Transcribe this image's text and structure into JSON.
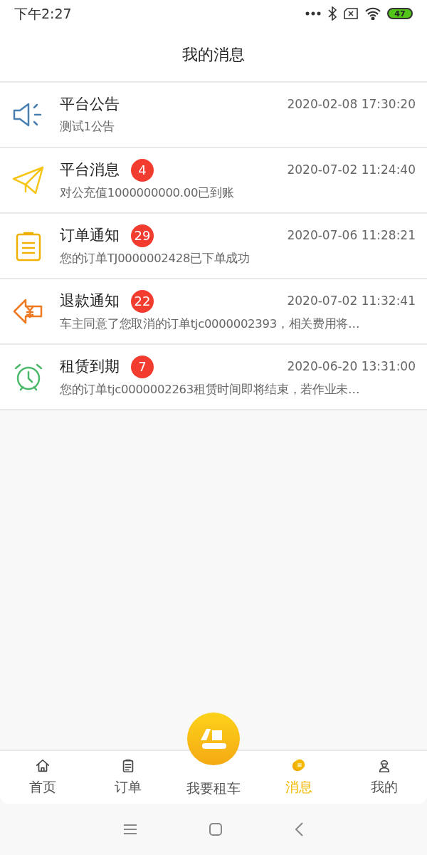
{
  "status_bar": {
    "time": "下午2:27",
    "battery": "47"
  },
  "header": {
    "title": "我的消息"
  },
  "messages": [
    {
      "kind": "announcement",
      "title": "平台公告",
      "time": "2020-02-08 17:30:20",
      "preview": "测试1公告"
    },
    {
      "kind": "platform",
      "title": "平台消息",
      "badge": "4",
      "time": "2020-07-02 11:24:40",
      "preview": "对公充值1000000000.00已到账"
    },
    {
      "kind": "order",
      "title": "订单通知",
      "badge": "29",
      "time": "2020-07-06 11:28:21",
      "preview": "您的订单TJ0000002428已下单成功"
    },
    {
      "kind": "refund",
      "title": "退款通知",
      "badge": "22",
      "time": "2020-07-02 11:32:41",
      "preview": "车主同意了您取消的订单tjc0000002393，相关费用将…"
    },
    {
      "kind": "expiry",
      "title": "租赁到期",
      "badge": "7",
      "time": "2020-06-20 13:31:00",
      "preview": "您的订单tjc0000002263租赁时间即将结束，若作业未…"
    }
  ],
  "tab_bar": [
    {
      "kind": "home",
      "label": "首页",
      "selected": false
    },
    {
      "kind": "orders",
      "label": "订单",
      "selected": false
    },
    {
      "kind": "rent",
      "label": "我要租车",
      "selected": false
    },
    {
      "kind": "messages",
      "label": "消息",
      "selected": true
    },
    {
      "kind": "profile",
      "label": "我的",
      "selected": false
    }
  ]
}
